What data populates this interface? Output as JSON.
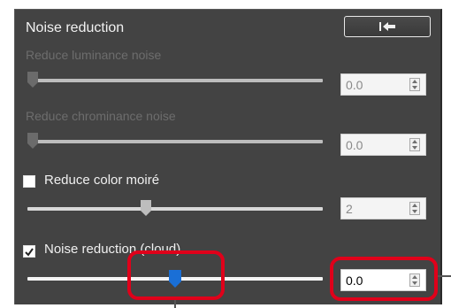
{
  "panel": {
    "title": "Noise reduction",
    "reset_button_icon": "undo-arrow-icon"
  },
  "luminance": {
    "label": "Reduce luminance noise",
    "value": "0.0",
    "enabled": false,
    "slider_fraction": 0.0
  },
  "chrominance": {
    "label": "Reduce chrominance noise",
    "value": "0.0",
    "enabled": false,
    "slider_fraction": 0.0
  },
  "moire": {
    "label": "Reduce color moiré",
    "checked": false,
    "value": "2",
    "enabled": false,
    "slider_fraction": 0.4
  },
  "cloud": {
    "label": "Noise reduction (cloud)",
    "checked": true,
    "value": "0.0",
    "enabled": true,
    "slider_fraction": 0.5
  },
  "colors": {
    "panel_background": "#434343",
    "highlight": "#e0001a",
    "active_thumb": "#1a6fd6"
  }
}
